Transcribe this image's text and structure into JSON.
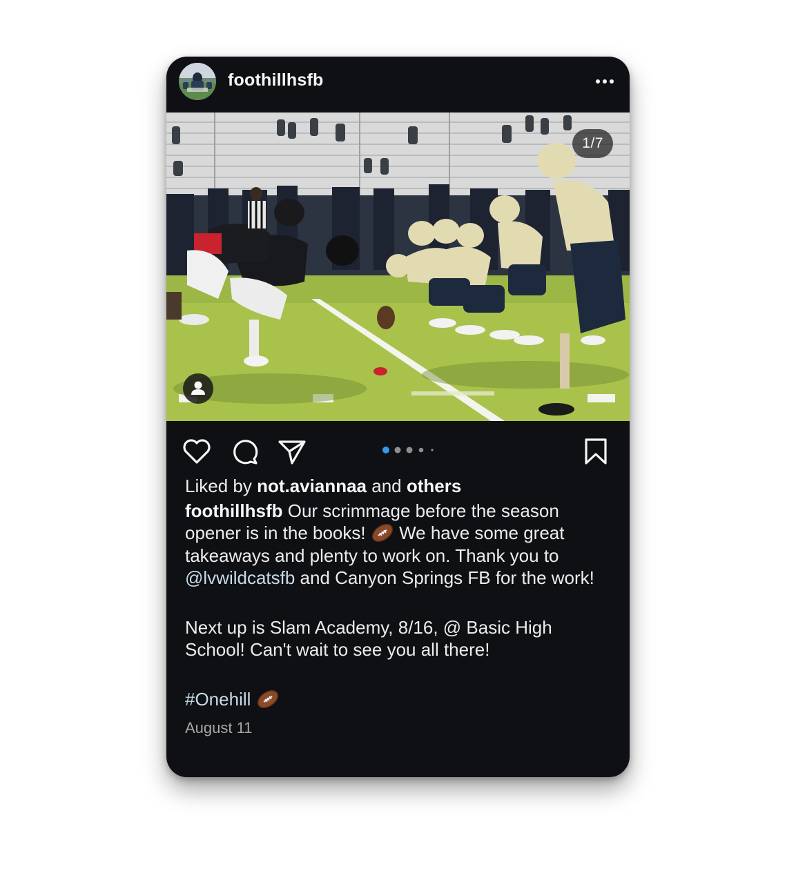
{
  "post": {
    "username": "foothillhsfb",
    "image_counter": "1/7",
    "carousel_position": 1,
    "carousel_total": 7
  },
  "likes": {
    "prefix": "Liked by",
    "user": "not.aviannaa",
    "conjunction": "and",
    "others": "others"
  },
  "caption": {
    "author": "foothillhsfb",
    "line1_text": " Our scrimmage before the season opener is in the books! ",
    "line1_after_emoji": " We have some great takeaways and plenty to work on. Thank you to ",
    "mention": "@lvwildcatsfb",
    "line1_end": " and Canyon Springs FB for the work!",
    "paragraph2": "Next up is Slam Academy, 8/16, @ Basic High School! Can't wait to see you all there!",
    "hashtag": "#Onehill",
    "date": "August 11"
  },
  "icons": {
    "header": [
      "more-icon"
    ],
    "actions": [
      "heart-icon",
      "comment-icon",
      "share-icon",
      "bookmark-icon"
    ],
    "photo": [
      "user-tag-icon"
    ],
    "emoji": "football-emoji"
  },
  "colors": {
    "background": "#0f1014",
    "text": "#ececec",
    "link": "#c6dbe9",
    "muted": "#a8a8a8",
    "carousel_active": "#3797f0",
    "carousel_inactive": "#8e8e8e"
  }
}
